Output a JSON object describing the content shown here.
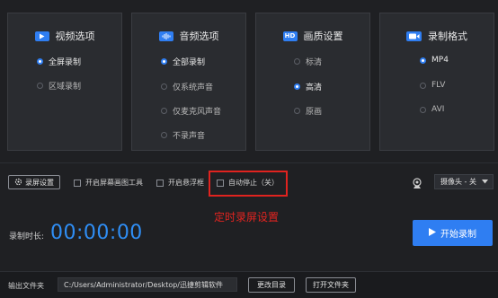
{
  "panels": [
    {
      "title": "视频选项",
      "icon": "video-icon",
      "options": [
        {
          "label": "全屏录制",
          "selected": true
        },
        {
          "label": "区域录制",
          "selected": false
        }
      ]
    },
    {
      "title": "音频选项",
      "icon": "audio-icon",
      "options": [
        {
          "label": "全部录制",
          "selected": true
        },
        {
          "label": "仅系统声音",
          "selected": false
        },
        {
          "label": "仅麦克风声音",
          "selected": false
        },
        {
          "label": "不录声音",
          "selected": false
        }
      ]
    },
    {
      "title": "画质设置",
      "icon": "hd-icon",
      "icon_text": "HD",
      "options": [
        {
          "label": "标清",
          "selected": false
        },
        {
          "label": "高清",
          "selected": true
        },
        {
          "label": "原画",
          "selected": false
        }
      ]
    },
    {
      "title": "录制格式",
      "icon": "camera-icon",
      "options": [
        {
          "label": "MP4",
          "selected": true
        },
        {
          "label": "FLV",
          "selected": false
        },
        {
          "label": "AVI",
          "selected": false
        }
      ]
    }
  ],
  "toolbar": {
    "settings_label": "录屏设置",
    "checkboxes": [
      {
        "label": "开启屏幕画图工具",
        "checked": false
      },
      {
        "label": "开启悬浮框",
        "checked": false
      },
      {
        "label": "自动停止（关）",
        "checked": false
      }
    ],
    "camera_select": "摄像头 - 关"
  },
  "annotation": "定时录屏设置",
  "duration": {
    "label": "录制时长:",
    "value": "00:00:00"
  },
  "start_button": "开始录制",
  "output": {
    "label": "输出文件夹",
    "path": "C:/Users/Administrator/Desktop/迅捷剪辑软件",
    "change_button": "更改目录",
    "open_button": "打开文件夹"
  },
  "colors": {
    "accent": "#2f7ef2",
    "annotation": "#e0231f",
    "background": "#1f2023"
  }
}
